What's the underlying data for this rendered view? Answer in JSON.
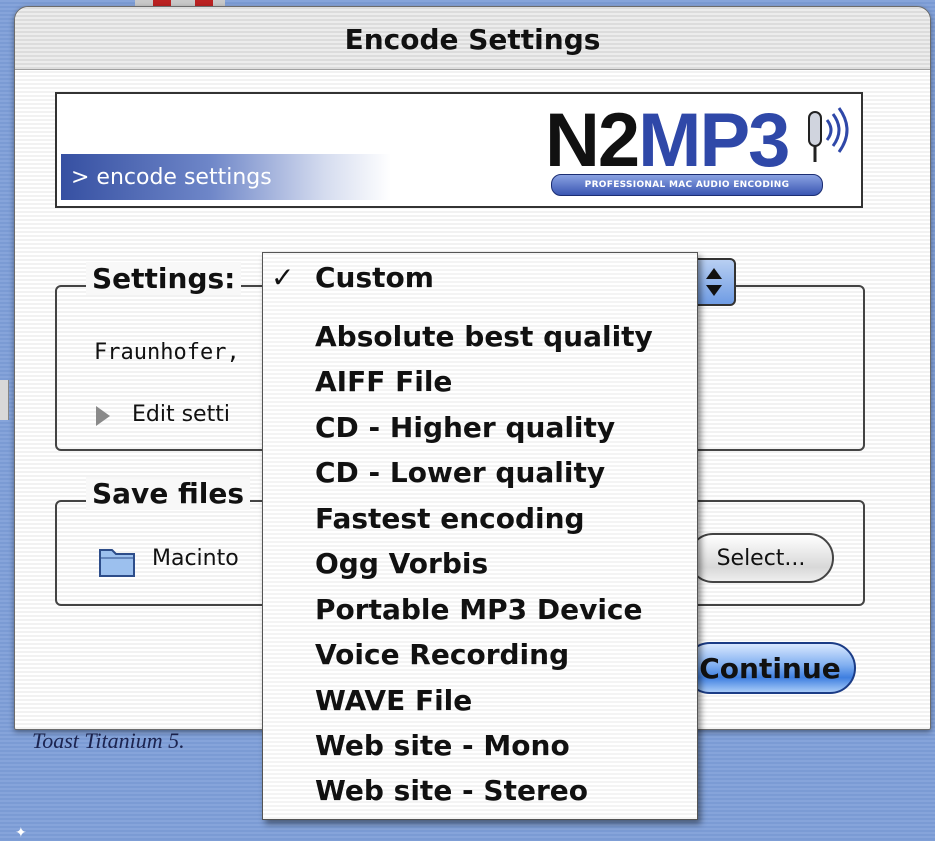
{
  "window": {
    "title": "Encode Settings"
  },
  "banner": {
    "label": "> encode settings",
    "logo_text_n2": "N2",
    "logo_text_mp3": "MP3",
    "logo_tagline": "PROFESSIONAL MAC AUDIO ENCODING"
  },
  "settings_group": {
    "label": "Settings:",
    "codec_text": "Fraunhofer,",
    "edit_label": "Edit setti"
  },
  "save_group": {
    "label": "Save files",
    "disk_text": "Macinto",
    "select_label": "Select..."
  },
  "buttons": {
    "continue_label": "Continue"
  },
  "menu": {
    "check": "✓",
    "items": [
      "Custom",
      "Absolute best quality",
      "AIFF File",
      "CD - Higher quality",
      "CD - Lower quality",
      "Fastest encoding",
      "Ogg Vorbis",
      "Portable MP3 Device",
      "Voice Recording",
      "WAVE File",
      "Web site - Mono",
      "Web site - Stereo"
    ]
  },
  "background": {
    "bottom_text": "Toast Titanium 5."
  },
  "icons": [
    "disclosure-triangle-icon",
    "folder-icon",
    "popup-arrows-icon",
    "sound-waves-icon",
    "checkmark-icon"
  ],
  "colors": {
    "accent_blue": "#3f7fe0",
    "desktop": "#7f9ed6",
    "logo_blue": "#2f48a8"
  }
}
